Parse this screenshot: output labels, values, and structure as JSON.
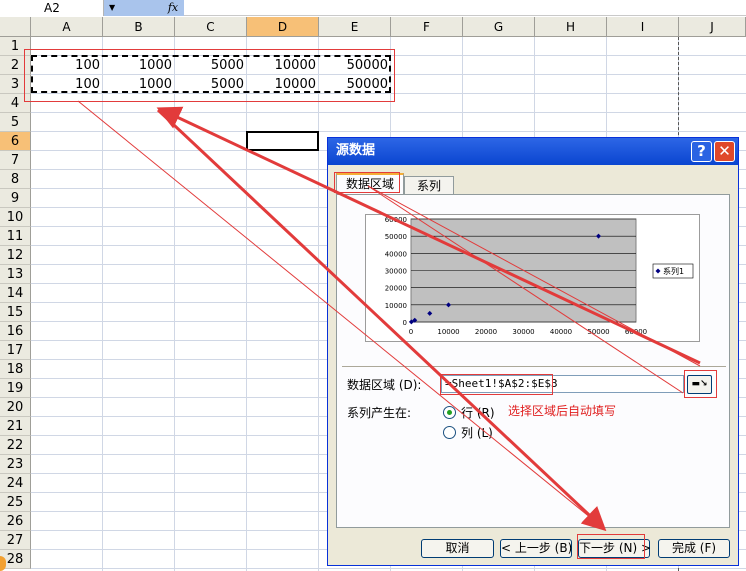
{
  "formula_bar": {
    "name_box": "A2",
    "fx_icon": "fx"
  },
  "columns": [
    "A",
    "B",
    "C",
    "D",
    "E",
    "F",
    "G",
    "H",
    "I",
    "J"
  ],
  "selected_column": "D",
  "rows": [
    "1",
    "2",
    "3",
    "4",
    "5",
    "6",
    "7",
    "8",
    "9",
    "10",
    "11",
    "12",
    "13",
    "14",
    "15",
    "16",
    "17",
    "18",
    "19",
    "20",
    "21",
    "22",
    "23",
    "24",
    "25",
    "26",
    "27",
    "28"
  ],
  "selected_row": "6",
  "cells": {
    "row2": [
      "100",
      "1000",
      "5000",
      "10000",
      "50000"
    ],
    "row3": [
      "100",
      "1000",
      "5000",
      "10000",
      "50000"
    ]
  },
  "dialog": {
    "title": "源数据",
    "help_button": "?",
    "close_button": "✕",
    "tabs": [
      {
        "label": "数据区域",
        "active": true
      },
      {
        "label": "系列",
        "active": false
      }
    ],
    "data_range_label": "数据区域 (D):",
    "data_range_value": "=Sheet1!$A$2:$E$3",
    "series_in_label": "系列产生在:",
    "radio_rows": {
      "label": "行 (R)",
      "checked": true
    },
    "radio_cols": {
      "label": "列 (L)",
      "checked": false
    },
    "annotation": "选择区域后自动填写",
    "buttons": {
      "cancel": "取消",
      "back": "< 上一步 (B)",
      "next": "下一步 (N) >",
      "finish": "完成 (F)"
    }
  },
  "chart_data": {
    "type": "scatter",
    "x_ticks": [
      "0",
      "10000",
      "20000",
      "30000",
      "40000",
      "50000",
      "60000"
    ],
    "y_ticks": [
      "0",
      "10000",
      "20000",
      "30000",
      "40000",
      "50000",
      "60000"
    ],
    "xlim": [
      0,
      60000
    ],
    "ylim": [
      0,
      60000
    ],
    "series": [
      {
        "name": "系列1",
        "x": [
          100,
          1000,
          5000,
          10000,
          50000
        ],
        "y": [
          100,
          1000,
          5000,
          10000,
          50000
        ]
      }
    ],
    "grid": true,
    "legend": "right",
    "plot_bg": "#c0c0c0",
    "marker_color": "#000080"
  },
  "colors": {
    "annotation_red": "#e23b3b",
    "header_bg": "#ebeae0",
    "header_selected": "#f7c077",
    "titlebar_blue": "#0a45d0"
  }
}
